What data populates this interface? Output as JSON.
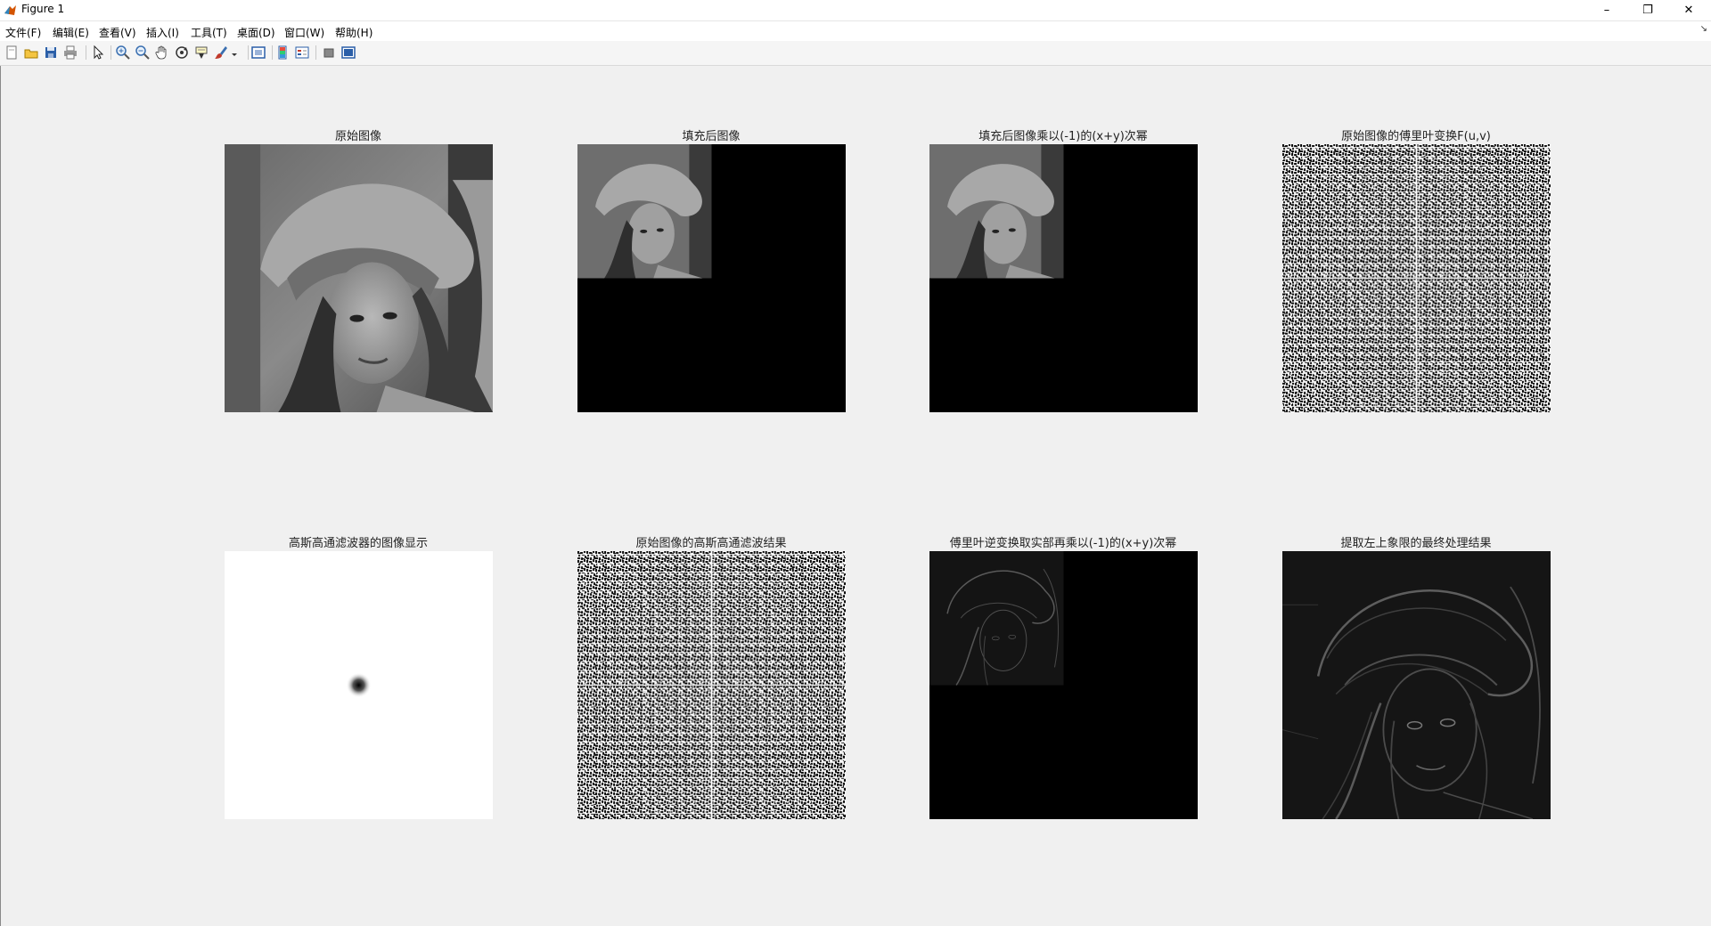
{
  "window": {
    "title": "Figure 1",
    "app_icon": "matlab-icon",
    "controls": [
      "minimize-icon",
      "restore-icon",
      "close-icon"
    ]
  },
  "menu": {
    "items": [
      "文件(F)",
      "编辑(E)",
      "查看(V)",
      "插入(I)",
      "工具(T)",
      "桌面(D)",
      "窗口(W)",
      "帮助(H)"
    ]
  },
  "toolbar": {
    "buttons": [
      "new-figure-icon",
      "open-file-icon",
      "save-icon",
      "print-icon",
      "edit-plot-arrow-icon",
      "zoom-in-icon",
      "zoom-out-icon",
      "pan-hand-icon",
      "rotate-3d-icon",
      "data-cursor-icon",
      "brush-icon",
      "link-plot-icon",
      "insert-colorbar-icon",
      "insert-legend-icon",
      "hide-plot-tools-icon",
      "show-plot-tools-icon"
    ]
  },
  "subplots": [
    {
      "title": "原始图像",
      "content": "lena-original"
    },
    {
      "title": "填充后图像",
      "content": "padded-image"
    },
    {
      "title": "填充后图像乘以(-1)的(x+y)次幂",
      "content": "centered-padded-image"
    },
    {
      "title": "原始图像的傅里叶变换F(u,v)",
      "content": "fourier-spectrum-noise"
    },
    {
      "title": "高斯高通滤波器的图像显示",
      "content": "gaussian-highpass-filter"
    },
    {
      "title": "原始图像的高斯高通滤波结果",
      "content": "filtered-spectrum-noise"
    },
    {
      "title": "傅里叶逆变换取实部再乘以(-1)的(x+y)次幂",
      "content": "inverse-padded-edges"
    },
    {
      "title": "提取左上象限的最终处理结果",
      "content": "final-edge-result"
    }
  ],
  "colors": {
    "figure_background": "#f0f0f0",
    "black": "#000000",
    "white": "#ffffff"
  }
}
